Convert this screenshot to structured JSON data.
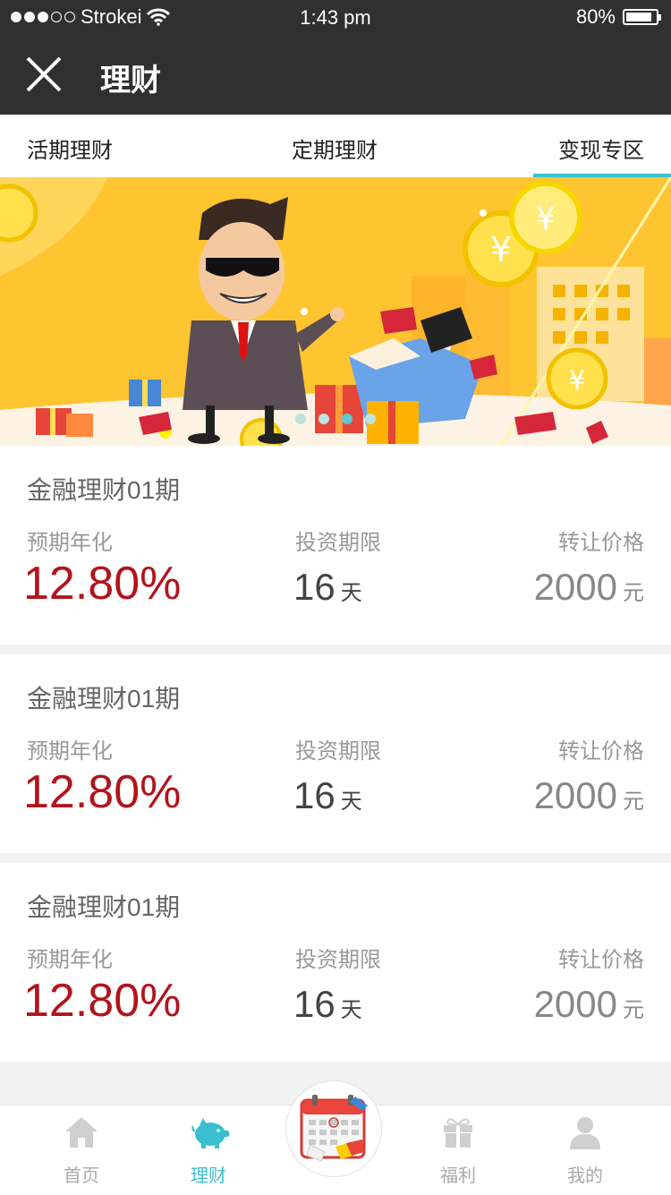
{
  "status_bar": {
    "carrier": "Strokei",
    "time": "1:43 pm",
    "battery": "80%"
  },
  "nav": {
    "title": "理财"
  },
  "tabs": [
    {
      "label": "活期理财",
      "active": false
    },
    {
      "label": "定期理财",
      "active": false
    },
    {
      "label": "变现专区",
      "active": true
    }
  ],
  "banner": {
    "page_indicator": {
      "count": 4,
      "active_index": 2
    }
  },
  "products": [
    {
      "name": "金融理财01期",
      "rate_label": "预期年化",
      "rate": "12.80%",
      "term_label": "投资期限",
      "term": "16",
      "term_unit": "天",
      "price_label": "转让价格",
      "price": "2000",
      "price_unit": "元"
    },
    {
      "name": "金融理财01期",
      "rate_label": "预期年化",
      "rate": "12.80%",
      "term_label": "投资期限",
      "term": "16",
      "term_unit": "天",
      "price_label": "转让价格",
      "price": "2000",
      "price_unit": "元"
    },
    {
      "name": "金融理财01期",
      "rate_label": "预期年化",
      "rate": "12.80%",
      "term_label": "投资期限",
      "term": "16",
      "term_unit": "天",
      "price_label": "转让价格",
      "price": "2000",
      "price_unit": "元"
    }
  ],
  "tab_bar": {
    "items": [
      {
        "label": "首页",
        "icon": "home-icon",
        "active": false
      },
      {
        "label": "理财",
        "icon": "piggy-bank-icon",
        "active": true
      },
      {
        "label": "",
        "icon": "calendar-icon",
        "active": false
      },
      {
        "label": "福利",
        "icon": "gift-icon",
        "active": false
      },
      {
        "label": "我的",
        "icon": "user-icon",
        "active": false
      }
    ]
  },
  "colors": {
    "accent": "#39c3d6",
    "rate_red": "#b2141b",
    "dark_bar": "#303030",
    "banner_yellow": "#ffc531"
  }
}
